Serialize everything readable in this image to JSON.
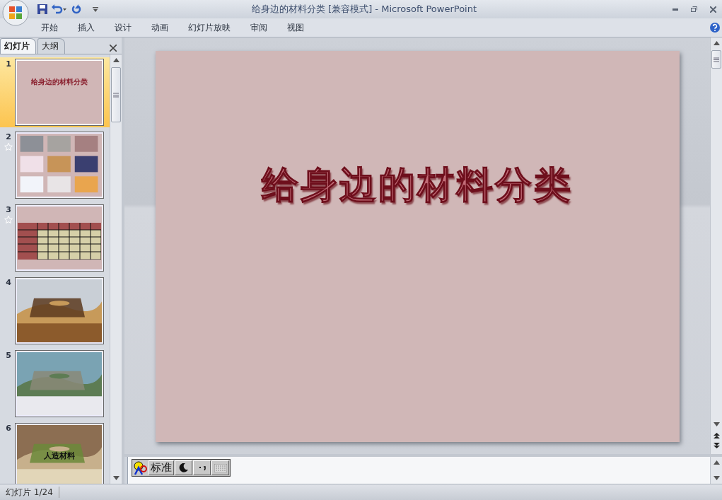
{
  "window": {
    "title": "给身边的材料分类 [兼容模式] - Microsoft PowerPoint"
  },
  "ribbon_tabs": [
    "开始",
    "插入",
    "设计",
    "动画",
    "幻灯片放映",
    "审阅",
    "视图"
  ],
  "panel_tabs": [
    {
      "label": "幻灯片",
      "selected": true
    },
    {
      "label": "大纲",
      "selected": false
    }
  ],
  "slides": [
    {
      "number": "1",
      "kind": "title",
      "title": "给身边的材料分类",
      "selected": true,
      "animated": false
    },
    {
      "number": "2",
      "kind": "photo-grid",
      "selected": false,
      "animated": true
    },
    {
      "number": "3",
      "kind": "table",
      "selected": false,
      "animated": true
    },
    {
      "number": "4",
      "kind": "framed-photo",
      "selected": false,
      "animated": false
    },
    {
      "number": "5",
      "kind": "framed-photo",
      "selected": false,
      "animated": false
    },
    {
      "number": "6",
      "kind": "photo-title",
      "title": "人造材料",
      "selected": false,
      "animated": false
    }
  ],
  "current_slide": {
    "title": "给身边的材料分类"
  },
  "ime_bar": {
    "mode": "标准"
  },
  "status_bar": {
    "slide_info": "幻灯片 1/24"
  }
}
